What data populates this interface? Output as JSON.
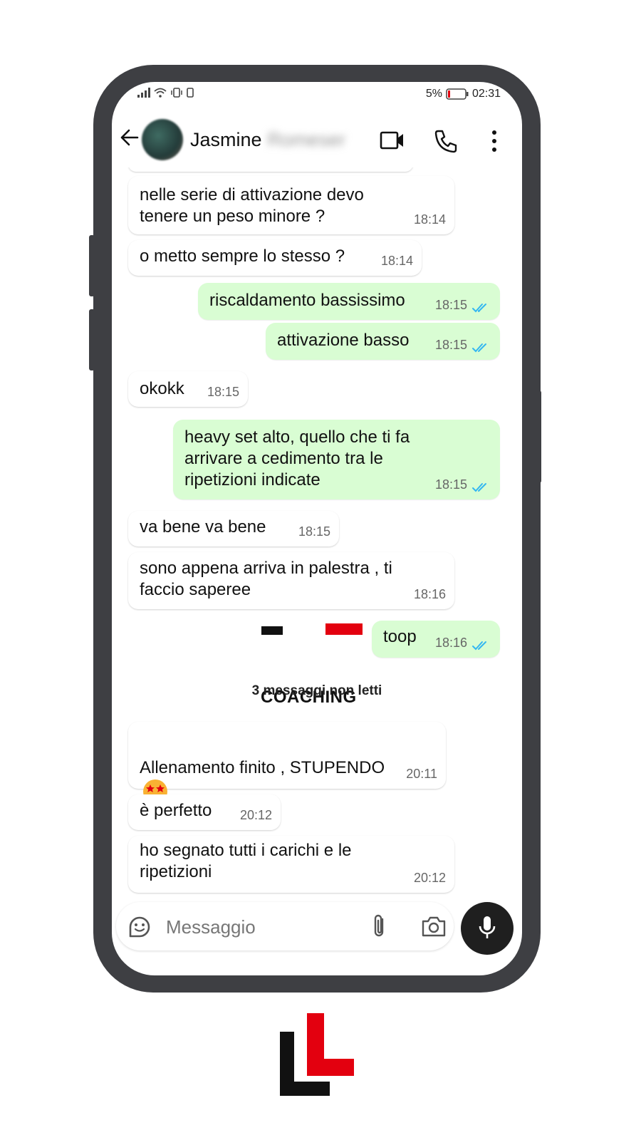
{
  "status": {
    "battery": "5%",
    "time": "02:31"
  },
  "header": {
    "contact_name": "Jasmine",
    "contact_surname_blurred": "Romeser"
  },
  "messages": [
    {
      "text": "nelle serie di attivazione devo\ntenere un peso minore ?",
      "time": "18:14"
    },
    {
      "text": "o metto sempre lo stesso ?",
      "time": "18:14"
    },
    {
      "text": "riscaldamento bassissimo",
      "time": "18:15"
    },
    {
      "text": "attivazione basso",
      "time": "18:15"
    },
    {
      "text": "okokk",
      "time": "18:15"
    },
    {
      "text": "heavy set alto, quello che ti fa\narrivare a cedimento tra le\nripetizioni indicate",
      "time": "18:15"
    },
    {
      "text": "va bene va bene",
      "time": "18:15"
    },
    {
      "text": "sono appena arriva in palestra , ti\nfaccio saperee",
      "time": "18:16"
    },
    {
      "text": "toop",
      "time": "18:16"
    },
    {
      "text": "Allenamento finito , STUPENDO",
      "time": "20:11"
    },
    {
      "text": "è perfetto",
      "time": "20:12"
    },
    {
      "text": "ho segnato tutti i carichi e le\nripetizioni",
      "time": "20:12"
    }
  ],
  "unread_divider": "3 messaggi non letti",
  "watermark": "COACHING",
  "input": {
    "placeholder": "Messaggio"
  },
  "colors": {
    "outgoing_bubble": "#d9fdd3",
    "read_ticks": "#34b7f1",
    "phone_frame": "#3e3f43",
    "logo_red": "#e3000f"
  }
}
